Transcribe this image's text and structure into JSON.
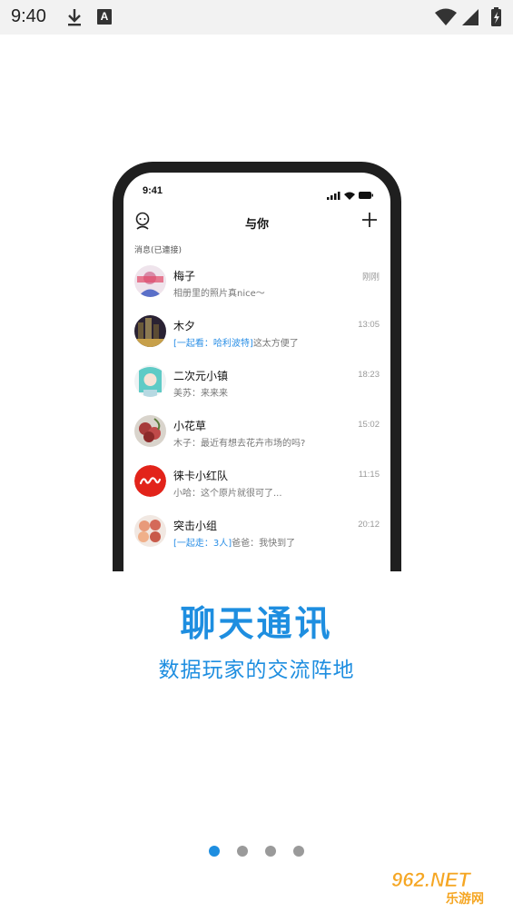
{
  "status_bar": {
    "time": "9:40",
    "a_badge": "A"
  },
  "phone": {
    "status_time": "9:41",
    "header_title": "与你",
    "section_label": "消息(已連接)",
    "chats": [
      {
        "name": "梅子",
        "tag": "",
        "preview": "相册里的照片真nice～",
        "time": "刚刚"
      },
      {
        "name": "木夕",
        "tag": "[一起看：哈利波特]",
        "preview": "这太方便了",
        "time": "13:05"
      },
      {
        "name": "二次元小镇",
        "tag": "",
        "preview": "美苏：来来来",
        "time": "18:23"
      },
      {
        "name": "小花草",
        "tag": "",
        "preview": "木子：最近有想去花卉市场的吗?",
        "time": "15:02"
      },
      {
        "name": "徕卡小红队",
        "tag": "",
        "preview": "小哈：这个原片就很可了...",
        "time": "11:15"
      },
      {
        "name": "突击小组",
        "tag": "[一起走：3人]",
        "preview": "爸爸：我快到了",
        "time": "20:12"
      }
    ]
  },
  "headline": "聊天通讯",
  "subheadline": "数据玩家的交流阵地",
  "pagination": {
    "total": 4,
    "active": 1
  },
  "watermark": {
    "top_text": "962.NET",
    "bottom_text": "乐游网"
  },
  "colors": {
    "accent": "#1e8ee0",
    "phone_frame": "#1f1f1f",
    "status_bar": "#f2f2f2"
  }
}
